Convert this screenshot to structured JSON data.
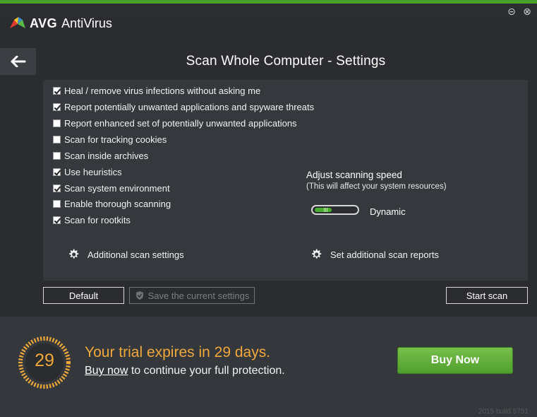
{
  "app": {
    "brand": "AVG",
    "product": "AntiVirus"
  },
  "window": {
    "minimize_glyph": "⊝",
    "close_glyph": "⊗"
  },
  "page": {
    "title": "Scan Whole Computer - Settings",
    "back_icon": "arrow-left-icon"
  },
  "options": [
    {
      "label": "Heal / remove virus infections without asking me",
      "checked": true
    },
    {
      "label": "Report potentially unwanted applications and spyware threats",
      "checked": true
    },
    {
      "label": "Report enhanced set of potentially unwanted applications",
      "checked": false
    },
    {
      "label": "Scan for tracking cookies",
      "checked": false
    },
    {
      "label": "Scan inside archives",
      "checked": false
    },
    {
      "label": "Use heuristics",
      "checked": true
    },
    {
      "label": "Scan system environment",
      "checked": true
    },
    {
      "label": "Enable thorough scanning",
      "checked": false
    },
    {
      "label": "Scan for rootkits",
      "checked": true
    }
  ],
  "speed": {
    "title": "Adjust scanning speed",
    "subtitle": "(This will affect your system resources)",
    "value_label": "Dynamic",
    "level": 0.4
  },
  "links": {
    "additional_scan": "Additional scan settings",
    "scan_reports": "Set additional scan reports"
  },
  "buttons": {
    "default": "Default",
    "save": "Save the current settings",
    "start": "Start scan"
  },
  "trial": {
    "days": "29",
    "title": "Your trial expires in 29 days.",
    "link": "Buy now",
    "rest": " to continue your full protection.",
    "buy_button": "Buy Now"
  },
  "build": "2015  build 5751",
  "colors": {
    "accent_green": "#4aa329",
    "trial_orange": "#f0a83a"
  }
}
